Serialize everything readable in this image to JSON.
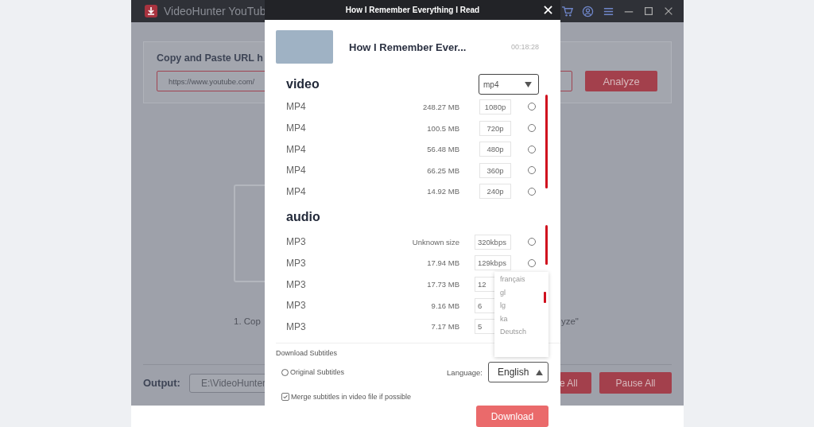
{
  "app": {
    "title": "VideoHunter YouTub",
    "url_label": "Copy and Paste URL h",
    "url_placeholder": "https://www.youtube.com/",
    "analyze_button": "Analyze",
    "hint_left": "1. Cop",
    "hint_right": "yze\"",
    "output_label": "Output:",
    "output_path": "E:\\VideoHunter",
    "buttons": [
      "e All",
      "Pause All"
    ]
  },
  "dialog": {
    "title": "How I Remember Everything I Read",
    "video_title": "How I Remember Ever...",
    "duration": "00:18:28",
    "sections": [
      {
        "heading": "video",
        "format_select": "mp4",
        "options": [
          {
            "format": "MP4",
            "size": "248.27 MB",
            "quality": "1080p",
            "selected": false
          },
          {
            "format": "MP4",
            "size": "100.5 MB",
            "quality": "720p",
            "selected": false
          },
          {
            "format": "MP4",
            "size": "56.48 MB",
            "quality": "480p",
            "selected": false
          },
          {
            "format": "MP4",
            "size": "66.25 MB",
            "quality": "360p",
            "selected": false
          },
          {
            "format": "MP4",
            "size": "14.92 MB",
            "quality": "240p",
            "selected": false
          }
        ]
      },
      {
        "heading": "audio",
        "options": [
          {
            "format": "MP3",
            "size": "Unknown size",
            "quality": "320kbps",
            "selected": false
          },
          {
            "format": "MP3",
            "size": "17.94 MB",
            "quality": "129kbps",
            "selected": false
          },
          {
            "format": "MP3",
            "size": "17.73 MB",
            "quality": "12",
            "selected": false
          },
          {
            "format": "MP3",
            "size": "9.16 MB",
            "quality": "6",
            "selected": false
          },
          {
            "format": "MP3",
            "size": "7.17 MB",
            "quality": "5",
            "selected": false
          }
        ]
      }
    ],
    "subtitles": {
      "heading": "Download Subtitles",
      "original": {
        "label": "Original Subtitles",
        "selected": false
      },
      "language_label": "Language:",
      "language": "English",
      "expanded": true,
      "language_options": [
        "français",
        "gl",
        "lg",
        "ka",
        "Deutsch"
      ],
      "merge": {
        "label": "Merge subtitles in video file if possible",
        "checked": true
      }
    },
    "download_button": "Download"
  }
}
